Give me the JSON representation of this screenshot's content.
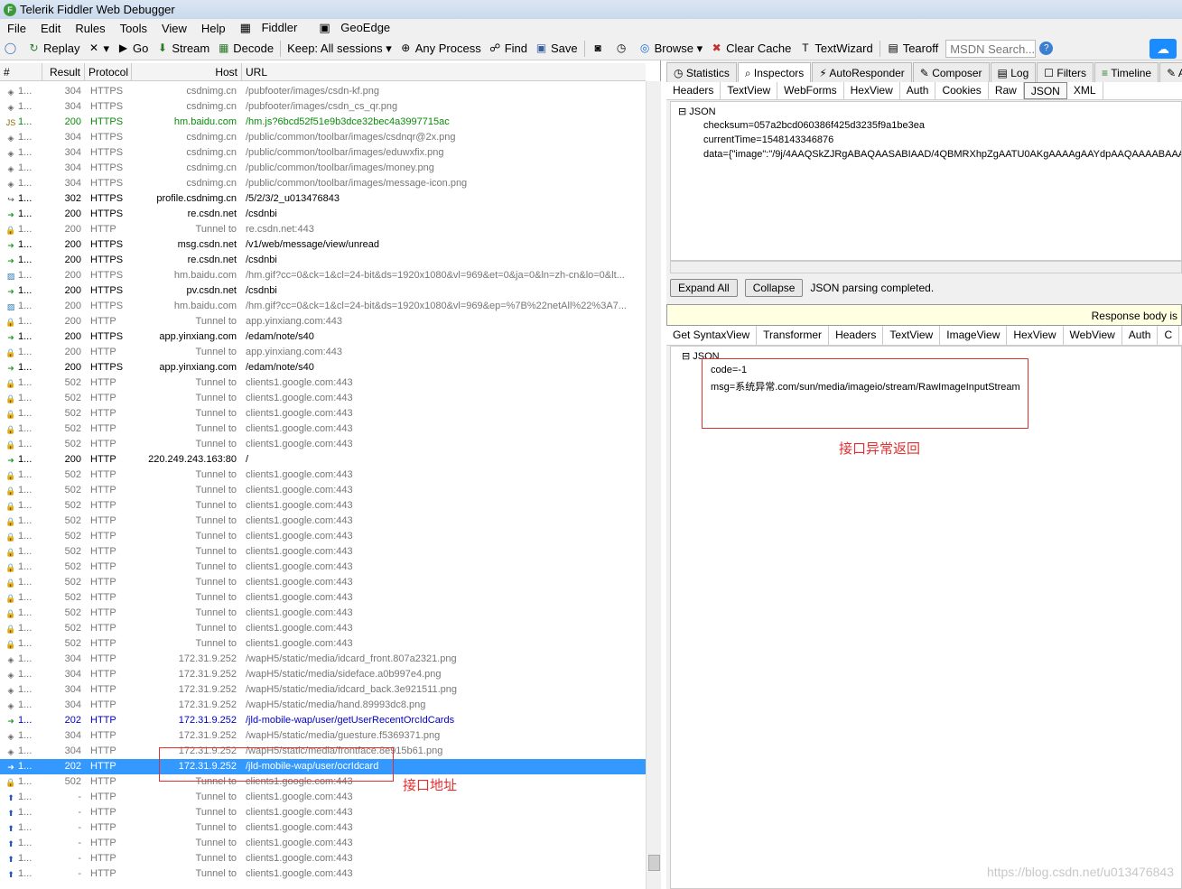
{
  "window": {
    "title": "Telerik Fiddler Web Debugger"
  },
  "menu": [
    "File",
    "Edit",
    "Rules",
    "Tools",
    "View",
    "Help",
    "Fiddler",
    "GeoEdge"
  ],
  "toolbar": {
    "replay": "Replay",
    "go": "Go",
    "stream": "Stream",
    "decode": "Decode",
    "keep": "Keep: All sessions",
    "process": "Any Process",
    "find": "Find",
    "save": "Save",
    "browse": "Browse",
    "clear_cache": "Clear Cache",
    "textwizard": "TextWizard",
    "tearoff": "Tearoff",
    "msdn": "MSDN Search..."
  },
  "grid": {
    "headers": {
      "num": "#",
      "result": "Result",
      "protocol": "Protocol",
      "host": "Host",
      "url": "URL"
    },
    "rows": [
      {
        "n": "1...",
        "r": "304",
        "p": "HTTPS",
        "h": "csdnimg.cn",
        "u": "/pubfooter/images/csdn-kf.png",
        "c": "gray",
        "i": "diamond"
      },
      {
        "n": "1...",
        "r": "304",
        "p": "HTTPS",
        "h": "csdnimg.cn",
        "u": "/pubfooter/images/csdn_cs_qr.png",
        "c": "gray",
        "i": "diamond"
      },
      {
        "n": "1...",
        "r": "200",
        "p": "HTTPS",
        "h": "hm.baidu.com",
        "u": "/hm.js?6bcd52f51e9b3dce32bec4a3997715ac",
        "c": "green",
        "i": "js"
      },
      {
        "n": "1...",
        "r": "304",
        "p": "HTTPS",
        "h": "csdnimg.cn",
        "u": "/public/common/toolbar/images/csdnqr@2x.png",
        "c": "gray",
        "i": "diamond"
      },
      {
        "n": "1...",
        "r": "304",
        "p": "HTTPS",
        "h": "csdnimg.cn",
        "u": "/public/common/toolbar/images/eduwxfix.png",
        "c": "gray",
        "i": "diamond"
      },
      {
        "n": "1...",
        "r": "304",
        "p": "HTTPS",
        "h": "csdnimg.cn",
        "u": "/public/common/toolbar/images/money.png",
        "c": "gray",
        "i": "diamond"
      },
      {
        "n": "1...",
        "r": "304",
        "p": "HTTPS",
        "h": "csdnimg.cn",
        "u": "/public/common/toolbar/images/message-icon.png",
        "c": "gray",
        "i": "diamond"
      },
      {
        "n": "1...",
        "r": "302",
        "p": "HTTPS",
        "h": "profile.csdnimg.cn",
        "u": "/5/2/3/2_u013476843",
        "c": "black",
        "i": "redirect"
      },
      {
        "n": "1...",
        "r": "200",
        "p": "HTTPS",
        "h": "re.csdn.net",
        "u": "/csdnbi",
        "c": "black",
        "i": "arrow"
      },
      {
        "n": "1...",
        "r": "200",
        "p": "HTTP",
        "h": "Tunnel to",
        "u": "re.csdn.net:443",
        "c": "gray",
        "i": "lock"
      },
      {
        "n": "1...",
        "r": "200",
        "p": "HTTPS",
        "h": "msg.csdn.net",
        "u": "/v1/web/message/view/unread",
        "c": "black",
        "i": "arrow"
      },
      {
        "n": "1...",
        "r": "200",
        "p": "HTTPS",
        "h": "re.csdn.net",
        "u": "/csdnbi",
        "c": "black",
        "i": "arrow"
      },
      {
        "n": "1...",
        "r": "200",
        "p": "HTTPS",
        "h": "hm.baidu.com",
        "u": "/hm.gif?cc=0&ck=1&cl=24-bit&ds=1920x1080&vl=969&et=0&ja=0&ln=zh-cn&lo=0&lt...",
        "c": "gray",
        "i": "img"
      },
      {
        "n": "1...",
        "r": "200",
        "p": "HTTPS",
        "h": "pv.csdn.net",
        "u": "/csdnbi",
        "c": "black",
        "i": "arrow"
      },
      {
        "n": "1...",
        "r": "200",
        "p": "HTTPS",
        "h": "hm.baidu.com",
        "u": "/hm.gif?cc=0&ck=1&cl=24-bit&ds=1920x1080&vl=969&ep=%7B%22netAll%22%3A7...",
        "c": "gray",
        "i": "img"
      },
      {
        "n": "1...",
        "r": "200",
        "p": "HTTP",
        "h": "Tunnel to",
        "u": "app.yinxiang.com:443",
        "c": "gray",
        "i": "lock"
      },
      {
        "n": "1...",
        "r": "200",
        "p": "HTTPS",
        "h": "app.yinxiang.com",
        "u": "/edam/note/s40",
        "c": "black",
        "i": "arrow"
      },
      {
        "n": "1...",
        "r": "200",
        "p": "HTTP",
        "h": "Tunnel to",
        "u": "app.yinxiang.com:443",
        "c": "gray",
        "i": "lock"
      },
      {
        "n": "1...",
        "r": "200",
        "p": "HTTPS",
        "h": "app.yinxiang.com",
        "u": "/edam/note/s40",
        "c": "black",
        "i": "arrow"
      },
      {
        "n": "1...",
        "r": "502",
        "p": "HTTP",
        "h": "Tunnel to",
        "u": "clients1.google.com:443",
        "c": "gray",
        "i": "lock"
      },
      {
        "n": "1...",
        "r": "502",
        "p": "HTTP",
        "h": "Tunnel to",
        "u": "clients1.google.com:443",
        "c": "gray",
        "i": "lock"
      },
      {
        "n": "1...",
        "r": "502",
        "p": "HTTP",
        "h": "Tunnel to",
        "u": "clients1.google.com:443",
        "c": "gray",
        "i": "lock"
      },
      {
        "n": "1...",
        "r": "502",
        "p": "HTTP",
        "h": "Tunnel to",
        "u": "clients1.google.com:443",
        "c": "gray",
        "i": "lock"
      },
      {
        "n": "1...",
        "r": "502",
        "p": "HTTP",
        "h": "Tunnel to",
        "u": "clients1.google.com:443",
        "c": "gray",
        "i": "lock"
      },
      {
        "n": "1...",
        "r": "200",
        "p": "HTTP",
        "h": "220.249.243.163:80",
        "u": "/",
        "c": "black",
        "i": "arrow"
      },
      {
        "n": "1...",
        "r": "502",
        "p": "HTTP",
        "h": "Tunnel to",
        "u": "clients1.google.com:443",
        "c": "gray",
        "i": "lock"
      },
      {
        "n": "1...",
        "r": "502",
        "p": "HTTP",
        "h": "Tunnel to",
        "u": "clients1.google.com:443",
        "c": "gray",
        "i": "lock"
      },
      {
        "n": "1...",
        "r": "502",
        "p": "HTTP",
        "h": "Tunnel to",
        "u": "clients1.google.com:443",
        "c": "gray",
        "i": "lock"
      },
      {
        "n": "1...",
        "r": "502",
        "p": "HTTP",
        "h": "Tunnel to",
        "u": "clients1.google.com:443",
        "c": "gray",
        "i": "lock"
      },
      {
        "n": "1...",
        "r": "502",
        "p": "HTTP",
        "h": "Tunnel to",
        "u": "clients1.google.com:443",
        "c": "gray",
        "i": "lock"
      },
      {
        "n": "1...",
        "r": "502",
        "p": "HTTP",
        "h": "Tunnel to",
        "u": "clients1.google.com:443",
        "c": "gray",
        "i": "lock"
      },
      {
        "n": "1...",
        "r": "502",
        "p": "HTTP",
        "h": "Tunnel to",
        "u": "clients1.google.com:443",
        "c": "gray",
        "i": "lock"
      },
      {
        "n": "1...",
        "r": "502",
        "p": "HTTP",
        "h": "Tunnel to",
        "u": "clients1.google.com:443",
        "c": "gray",
        "i": "lock"
      },
      {
        "n": "1...",
        "r": "502",
        "p": "HTTP",
        "h": "Tunnel to",
        "u": "clients1.google.com:443",
        "c": "gray",
        "i": "lock"
      },
      {
        "n": "1...",
        "r": "502",
        "p": "HTTP",
        "h": "Tunnel to",
        "u": "clients1.google.com:443",
        "c": "gray",
        "i": "lock"
      },
      {
        "n": "1...",
        "r": "502",
        "p": "HTTP",
        "h": "Tunnel to",
        "u": "clients1.google.com:443",
        "c": "gray",
        "i": "lock"
      },
      {
        "n": "1...",
        "r": "502",
        "p": "HTTP",
        "h": "Tunnel to",
        "u": "clients1.google.com:443",
        "c": "gray",
        "i": "lock"
      },
      {
        "n": "1...",
        "r": "304",
        "p": "HTTP",
        "h": "172.31.9.252",
        "u": "/wapH5/static/media/idcard_front.807a2321.png",
        "c": "gray",
        "i": "diamond"
      },
      {
        "n": "1...",
        "r": "304",
        "p": "HTTP",
        "h": "172.31.9.252",
        "u": "/wapH5/static/media/sideface.a0b997e4.png",
        "c": "gray",
        "i": "diamond"
      },
      {
        "n": "1...",
        "r": "304",
        "p": "HTTP",
        "h": "172.31.9.252",
        "u": "/wapH5/static/media/idcard_back.3e921511.png",
        "c": "gray",
        "i": "diamond"
      },
      {
        "n": "1...",
        "r": "304",
        "p": "HTTP",
        "h": "172.31.9.252",
        "u": "/wapH5/static/media/hand.89993dc8.png",
        "c": "gray",
        "i": "diamond"
      },
      {
        "n": "1...",
        "r": "202",
        "p": "HTTP",
        "h": "172.31.9.252",
        "u": "/jld-mobile-wap/user/getUserRecentOrcIdCards",
        "c": "blue",
        "i": "arrow"
      },
      {
        "n": "1...",
        "r": "304",
        "p": "HTTP",
        "h": "172.31.9.252",
        "u": "/wapH5/static/media/guesture.f5369371.png",
        "c": "gray",
        "i": "diamond"
      },
      {
        "n": "1...",
        "r": "304",
        "p": "HTTP",
        "h": "172.31.9.252",
        "u": "/wapH5/static/media/frontface.8e915b61.png",
        "c": "gray",
        "i": "diamond"
      },
      {
        "n": "1...",
        "r": "202",
        "p": "HTTP",
        "h": "172.31.9.252",
        "u": "/jld-mobile-wap/user/ocrIdcard",
        "c": "selected",
        "i": "arrow"
      },
      {
        "n": "1...",
        "r": "502",
        "p": "HTTP",
        "h": "Tunnel to",
        "u": "clients1.google.com:443",
        "c": "gray",
        "i": "lock"
      },
      {
        "n": "1...",
        "r": "-",
        "p": "HTTP",
        "h": "Tunnel to",
        "u": "clients1.google.com:443",
        "c": "gray",
        "i": "up"
      },
      {
        "n": "1...",
        "r": "-",
        "p": "HTTP",
        "h": "Tunnel to",
        "u": "clients1.google.com:443",
        "c": "gray",
        "i": "up"
      },
      {
        "n": "1...",
        "r": "-",
        "p": "HTTP",
        "h": "Tunnel to",
        "u": "clients1.google.com:443",
        "c": "gray",
        "i": "up"
      },
      {
        "n": "1...",
        "r": "-",
        "p": "HTTP",
        "h": "Tunnel to",
        "u": "clients1.google.com:443",
        "c": "gray",
        "i": "up"
      },
      {
        "n": "1...",
        "r": "-",
        "p": "HTTP",
        "h": "Tunnel to",
        "u": "clients1.google.com:443",
        "c": "gray",
        "i": "up"
      },
      {
        "n": "1...",
        "r": "-",
        "p": "HTTP",
        "h": "Tunnel to",
        "u": "clients1.google.com:443",
        "c": "gray",
        "i": "up"
      }
    ]
  },
  "right": {
    "top_tabs": [
      "Statistics",
      "Inspectors",
      "AutoResponder",
      "Composer",
      "Log",
      "Filters",
      "Timeline",
      "A"
    ],
    "req_tabs": [
      "Headers",
      "TextView",
      "WebForms",
      "HexView",
      "Auth",
      "Cookies",
      "Raw",
      "JSON",
      "XML"
    ],
    "req_tree": {
      "root": "JSON",
      "items": [
        "checksum=057a2bcd060386f425d3235f9a1be3ea",
        "currentTime=1548143346876",
        "data={\"image\":\"/9j/4AAQSkZJRgABAQAASABIAAD/4QBMRXhpZgAATU0AKgAAAAgAAYdpAAQAAAABAAAAG"
      ]
    },
    "expand_all": "Expand All",
    "collapse": "Collapse",
    "parse_status": "JSON parsing completed.",
    "warning": "Response body is",
    "resp_tabs": [
      "Get SyntaxView",
      "Transformer",
      "Headers",
      "TextView",
      "ImageView",
      "HexView",
      "WebView",
      "Auth",
      "C"
    ],
    "resp_tree": {
      "root": "JSON",
      "items": [
        "code=-1",
        "msg=系统异常.com/sun/media/imageio/stream/RawImageInputStream"
      ]
    }
  },
  "annotations": {
    "url_label": "接口地址",
    "error_label": "接口异常返回"
  },
  "watermark": "https://blog.csdn.net/u013476843",
  "colors": {
    "selected": "#3399ff",
    "green": "#0b8a0b",
    "blue": "#0000cc",
    "gray": "#777777",
    "annotation": "#e03030"
  }
}
